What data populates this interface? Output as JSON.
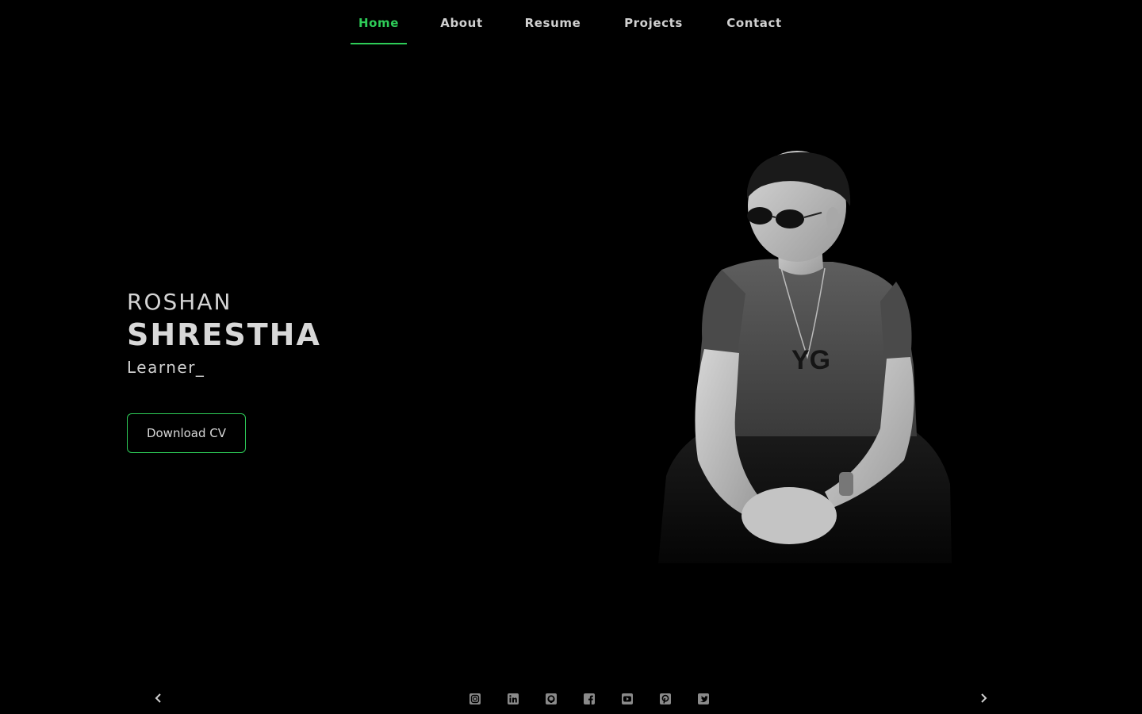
{
  "nav": {
    "items": [
      {
        "label": "Home",
        "active": true
      },
      {
        "label": "About",
        "active": false
      },
      {
        "label": "Resume",
        "active": false
      },
      {
        "label": "Projects",
        "active": false
      },
      {
        "label": "Contact",
        "active": false
      }
    ]
  },
  "hero": {
    "first_name": "ROSHAN",
    "last_name": "SHRESTHA",
    "role": "Learner_",
    "cv_button": "Download CV"
  },
  "footer": {
    "socials": [
      "instagram-icon",
      "linkedin-icon",
      "github-icon",
      "facebook-icon",
      "youtube-icon",
      "pinterest-icon",
      "twitter-icon"
    ],
    "prev_icon": "chevron-left-icon",
    "next_icon": "chevron-right-icon"
  },
  "colors": {
    "accent": "#2ecc58",
    "background": "#000000",
    "text": "#d8d8d8"
  }
}
